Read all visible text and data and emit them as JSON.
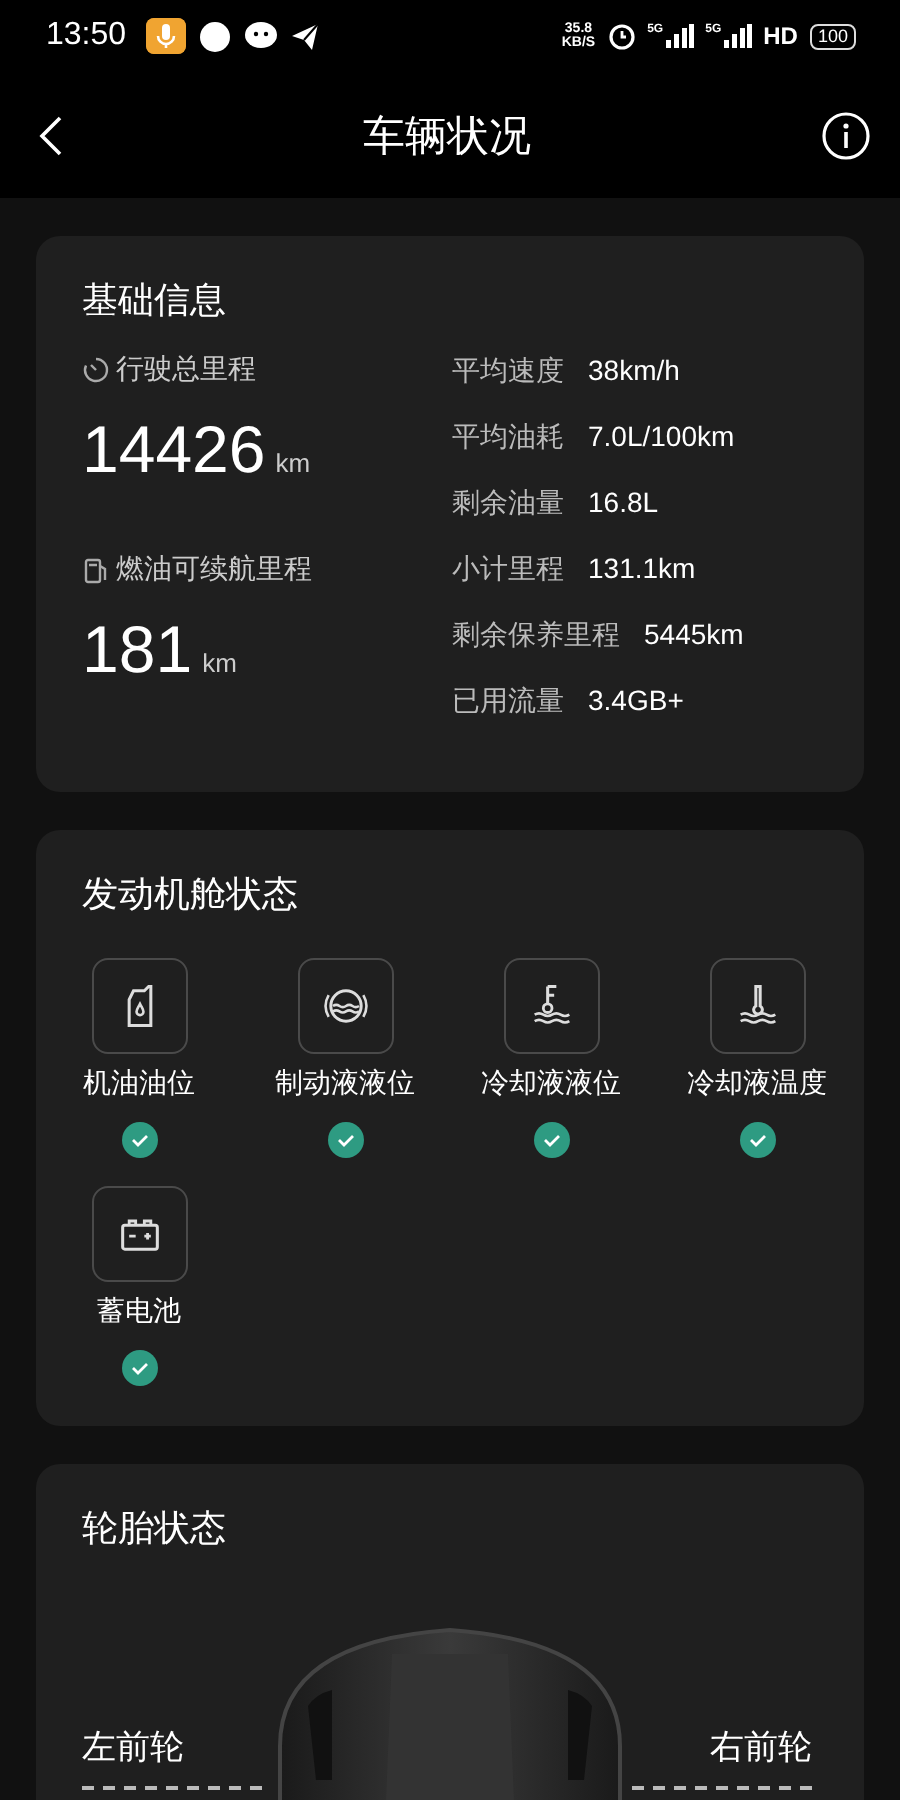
{
  "status_bar": {
    "time": "13:50",
    "speed_value": "35.8",
    "speed_unit": "KB/S",
    "network_1": "5G",
    "network_2": "5G",
    "hd": "HD",
    "battery": "100"
  },
  "header": {
    "title": "车辆状况"
  },
  "basic_info": {
    "title": "基础信息",
    "total_mileage": {
      "label": "行驶总里程",
      "value": "14426",
      "unit": "km"
    },
    "fuel_range": {
      "label": "燃油可续航里程",
      "value": "181",
      "unit": "km"
    },
    "stats": [
      {
        "label": "平均速度",
        "value": "38km/h"
      },
      {
        "label": "平均油耗",
        "value": "7.0L/100km"
      },
      {
        "label": "剩余油量",
        "value": "16.8L"
      },
      {
        "label": "小计里程",
        "value": "131.1km"
      },
      {
        "label": "剩余保养里程",
        "value": "5445km"
      },
      {
        "label": "已用流量",
        "value": "3.4GB+"
      }
    ]
  },
  "engine_status": {
    "title": "发动机舱状态",
    "items": [
      {
        "kind": "oil",
        "label": "机油油位",
        "ok": true
      },
      {
        "kind": "brake",
        "label": "制动液液位",
        "ok": true
      },
      {
        "kind": "coolant_level",
        "label": "冷却液液位",
        "ok": true
      },
      {
        "kind": "coolant_temp",
        "label": "冷却液温度",
        "ok": true
      },
      {
        "kind": "battery",
        "label": "蓄电池",
        "ok": true
      }
    ]
  },
  "tire_status": {
    "title": "轮胎状态",
    "tires": [
      {
        "label": "左前轮"
      },
      {
        "label": "右前轮"
      }
    ]
  }
}
